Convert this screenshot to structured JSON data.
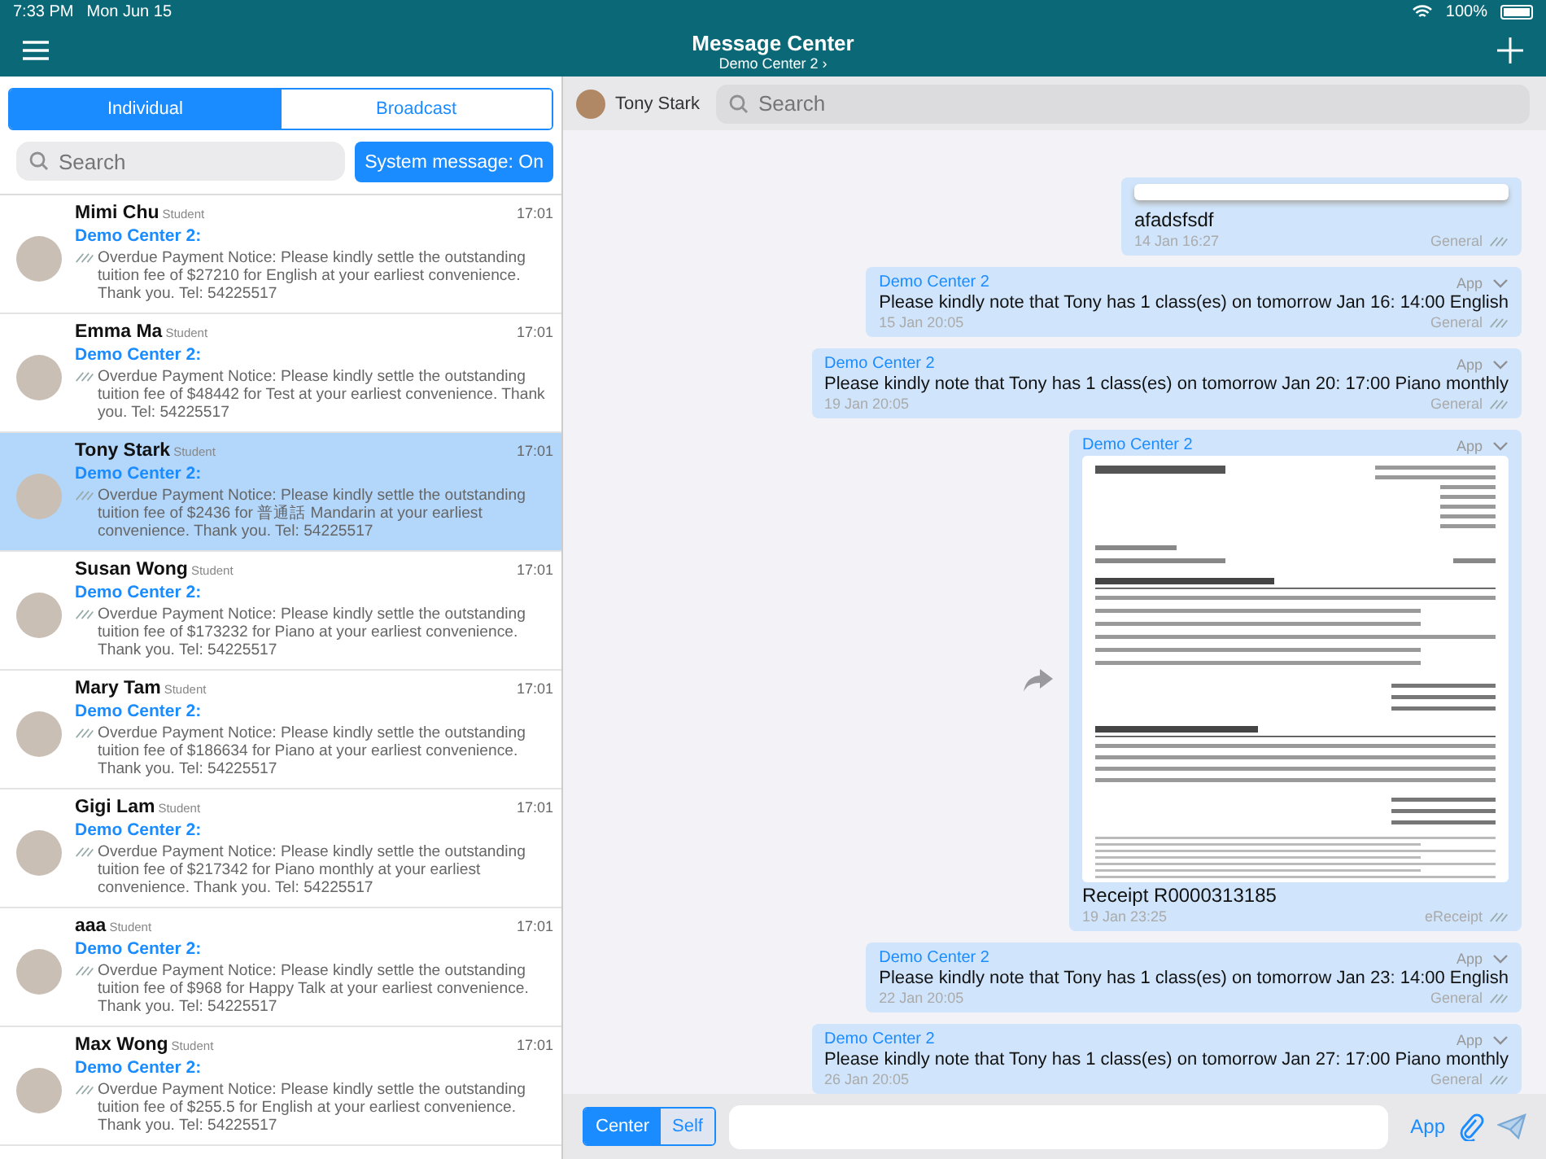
{
  "status_bar": {
    "time": "7:33 PM",
    "date": "Mon Jun 15",
    "battery": "100%"
  },
  "header": {
    "title": "Message Center",
    "subtitle": "Demo Center 2 ›"
  },
  "tabs": [
    {
      "label": "Individual",
      "selected": true
    },
    {
      "label": "Broadcast",
      "selected": false
    }
  ],
  "search": {
    "placeholder": "Search"
  },
  "system_button": "System message: On",
  "conversations": [
    {
      "name": "Mimi Chu",
      "role": "Student",
      "time": "17:01",
      "sender": "Demo Center 2:",
      "message": "Overdue Payment Notice: Please kindly settle the outstanding tuition fee of $27210 for English at your earliest convenience. Thank you. Tel: 54225517",
      "selected": false
    },
    {
      "name": "Emma Ma",
      "role": "Student",
      "time": "17:01",
      "sender": "Demo Center 2:",
      "message": "Overdue Payment Notice: Please kindly settle the outstanding tuition fee of $48442 for Test at your earliest convenience. Thank you. Tel: 54225517",
      "selected": false
    },
    {
      "name": "Tony Stark",
      "role": "Student",
      "time": "17:01",
      "sender": "Demo Center 2:",
      "message": "Overdue Payment Notice: Please kindly settle the outstanding tuition fee of $2436 for 普通話 Mandarin at your earliest convenience. Thank you. Tel: 54225517",
      "selected": true
    },
    {
      "name": "Susan Wong",
      "role": "Student",
      "time": "17:01",
      "sender": "Demo Center 2:",
      "message": "Overdue Payment Notice: Please kindly settle the outstanding tuition fee of $173232 for Piano at your earliest convenience. Thank you. Tel: 54225517",
      "selected": false
    },
    {
      "name": "Mary Tam",
      "role": "Student",
      "time": "17:01",
      "sender": "Demo Center 2:",
      "message": "Overdue Payment Notice: Please kindly settle the outstanding tuition fee of $186634 for Piano at your earliest convenience. Thank you. Tel: 54225517",
      "selected": false
    },
    {
      "name": "Gigi Lam",
      "role": "Student",
      "time": "17:01",
      "sender": "Demo Center 2:",
      "message": "Overdue Payment Notice: Please kindly settle the outstanding tuition fee of $217342 for Piano monthly at your earliest convenience. Thank you. Tel: 54225517",
      "selected": false
    },
    {
      "name": "aaa",
      "role": "Student",
      "time": "17:01",
      "sender": "Demo Center 2:",
      "message": "Overdue Payment Notice: Please kindly settle the outstanding tuition fee of $968 for Happy Talk at your earliest convenience. Thank you. Tel: 54225517",
      "selected": false
    },
    {
      "name": "Max Wong",
      "role": "Student",
      "time": "17:01",
      "sender": "Demo Center 2:",
      "message": "Overdue Payment Notice: Please kindly settle the outstanding tuition fee of $255.5 for English at your earliest convenience. Thank you. Tel: 54225517",
      "selected": false
    }
  ],
  "chat": {
    "contact": "Tony Stark",
    "search_placeholder": "Search",
    "messages": [
      {
        "kind": "image",
        "text": "afadsfsdf",
        "time": "14 Jan 16:27",
        "category": "General"
      },
      {
        "kind": "text",
        "sender": "Demo Center 2",
        "channel": "App",
        "text": "Please kindly note that Tony has 1 class(es) on tomorrow Jan 16: 14:00 English",
        "time": "15 Jan 20:05",
        "category": "General"
      },
      {
        "kind": "text",
        "sender": "Demo Center 2",
        "channel": "App",
        "text": "Please kindly note that Tony has 1 class(es) on tomorrow Jan 20: 17:00 Piano monthly",
        "time": "19 Jan 20:05",
        "category": "General"
      },
      {
        "kind": "receipt",
        "sender": "Demo Center 2",
        "channel": "App",
        "text": "Receipt R0000313185",
        "time": "19 Jan 23:25",
        "category": "eReceipt"
      },
      {
        "kind": "text",
        "sender": "Demo Center 2",
        "channel": "App",
        "text": "Please kindly note that Tony has 1 class(es) on tomorrow Jan 23: 14:00 English",
        "time": "22 Jan 20:05",
        "category": "General"
      },
      {
        "kind": "text",
        "sender": "Demo Center 2",
        "channel": "App",
        "text": "Please kindly note that Tony has 1 class(es) on tomorrow Jan 27: 17:00 Piano monthly",
        "time": "26 Jan 20:05",
        "category": "General"
      }
    ]
  },
  "composer": {
    "modes": [
      {
        "label": "Center",
        "selected": true
      },
      {
        "label": "Self",
        "selected": false
      }
    ],
    "app_label": "App"
  }
}
